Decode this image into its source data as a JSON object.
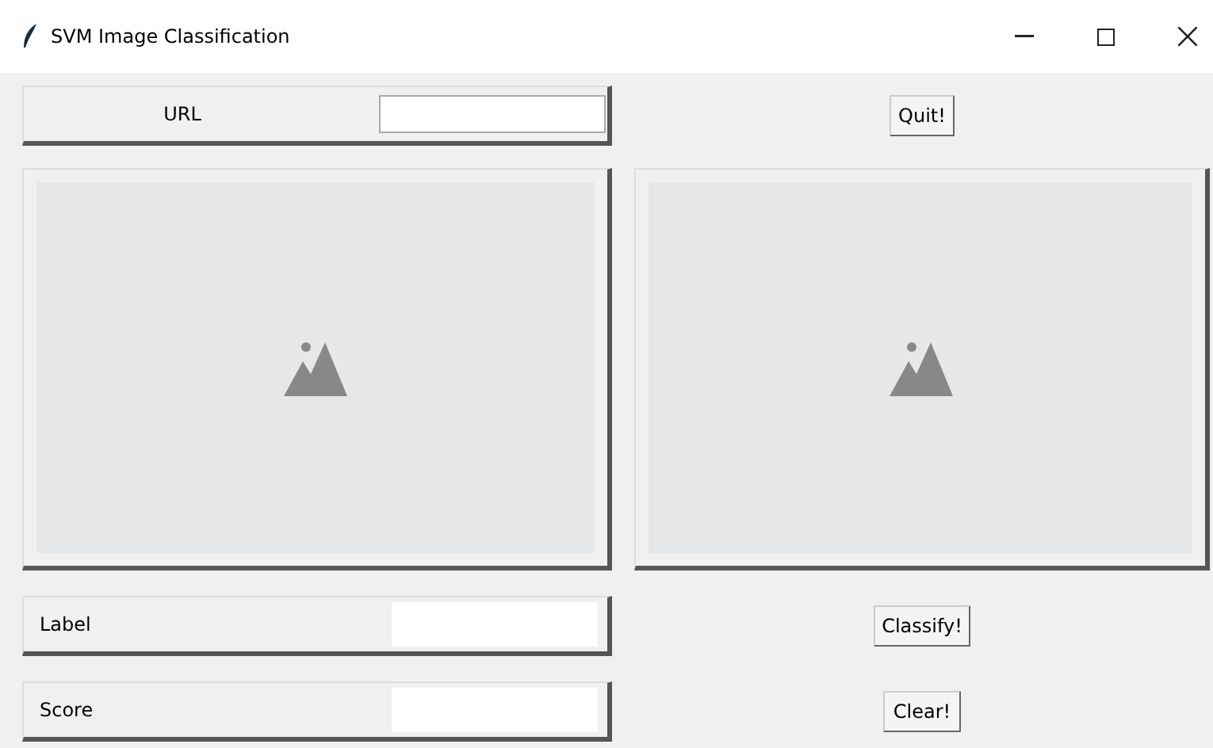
{
  "window": {
    "title": "SVM Image Classification"
  },
  "url_row": {
    "label": "URL"
  },
  "quit_button": {
    "label": "Quit!"
  },
  "image_panels": [
    {
      "kind": "placeholder"
    },
    {
      "kind": "placeholder"
    }
  ],
  "label_row": {
    "label": "Label"
  },
  "classify_button": {
    "label": "Classify!"
  },
  "score_row": {
    "label": "Score"
  },
  "clear_button": {
    "label": "Clear!"
  }
}
